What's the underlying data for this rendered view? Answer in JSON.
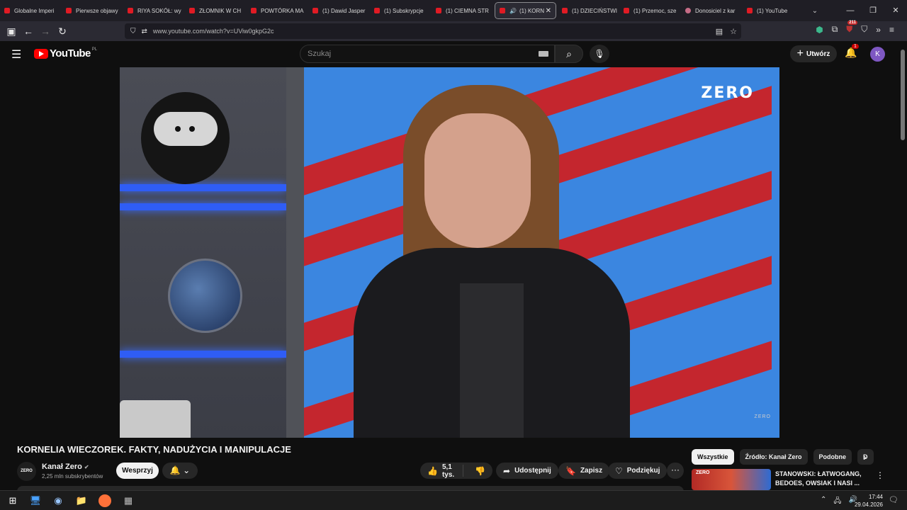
{
  "browser": {
    "tabs": [
      {
        "label": "Globalne Imperi"
      },
      {
        "label": "Pierwsze objawy"
      },
      {
        "label": "RIYA SOKÓŁ: wy"
      },
      {
        "label": "ZŁOMNIK W CH"
      },
      {
        "label": "POWTÓRKA MA"
      },
      {
        "label": "(1) Dawid Jasper"
      },
      {
        "label": "(1) Subskrypcje"
      },
      {
        "label": "(1) CIEMNA STR"
      },
      {
        "label": "(1) KORN"
      },
      {
        "label": "(1) DZIECIŃSTWI"
      },
      {
        "label": "(1) Przemoc, sze"
      },
      {
        "label": "Donosiciel z kar"
      },
      {
        "label": "(1) YouTube"
      }
    ],
    "url": "www.youtube.com/watch?v=UViw0gkpG2c",
    "extension_badge": "211"
  },
  "youtube": {
    "logo_text": "YouTube",
    "region": "PL",
    "search_placeholder": "Szukaj",
    "create_label": "Utwórz",
    "notification_count": "1",
    "avatar_letter": "K"
  },
  "video": {
    "watermark": "ZERO",
    "watermark_small": "ZERO",
    "title": "KORNELIA WIECZOREK. FAKTY, NADUŻYCIA I MANIPULACJE",
    "channel_name": "Kanał Zero",
    "channel_avatar_text": "ZERO",
    "subscribers": "2,25 mln subskrybentów",
    "support_label": "Wesprzyj",
    "likes": "5,1 tys.",
    "share_label": "Udostępnij",
    "save_label": "Zapisz",
    "thanks_label": "Podziękuj"
  },
  "sidebar": {
    "chips": [
      "Wszystkie",
      "Źródło: Kanał Zero",
      "Podobne",
      "D"
    ],
    "recommendation": {
      "title": "STANOWSKI: ŁATWOGANG, BEDOES, OWSIAK I NASI ...",
      "thumb_tag": "ZERO"
    }
  },
  "taskbar": {
    "time": "17:44",
    "date": "29.04.2026"
  }
}
